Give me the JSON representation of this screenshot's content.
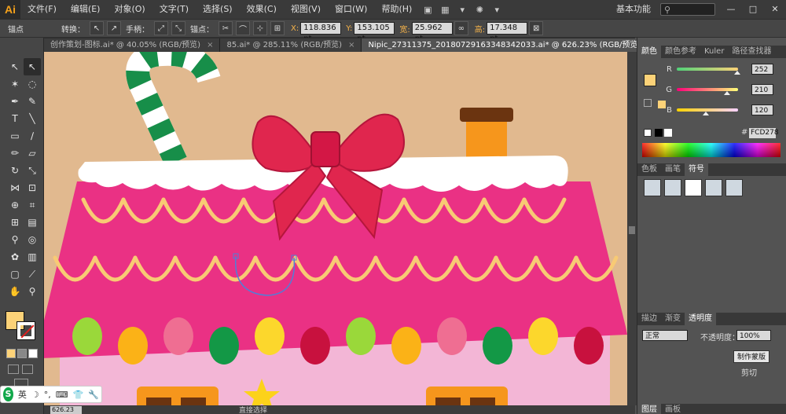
{
  "app": {
    "logo": "Ai"
  },
  "menu": [
    "文件(F)",
    "编辑(E)",
    "对象(O)",
    "文字(T)",
    "选择(S)",
    "效果(C)",
    "视图(V)",
    "窗口(W)",
    "帮助(H)"
  ],
  "header": {
    "workspace": "基本功能",
    "minimize": "—",
    "maximize": "□",
    "close": "✕"
  },
  "control_bar": {
    "selection_label": "锚点",
    "convert_label": "转换：",
    "handle_label": "手柄：",
    "anchor_label": "锚点：",
    "x_label": "X:",
    "x_value": "118.836 pt",
    "y_label": "Y:",
    "y_value": "153.105 pt",
    "w_label": "宽:",
    "w_value": "25.962 pt",
    "h_label": "高:",
    "h_value": "17.348 pt"
  },
  "tabs": [
    {
      "label": "创作策划-图标.ai* @ 40.05% (RGB/预览)",
      "active": false
    },
    {
      "label": "85.ai* @ 285.11% (RGB/预览)",
      "active": false
    },
    {
      "label": "Nipic_27311375_20180729163348342033.ai* @ 626.23% (RGB/预览)",
      "active": true
    }
  ],
  "tools": [
    {
      "name": "selection-tool-icon",
      "glyph": "↖"
    },
    {
      "name": "direct-selection-tool-icon",
      "glyph": "↖"
    },
    {
      "name": "magic-wand-icon",
      "glyph": "✶"
    },
    {
      "name": "lasso-icon",
      "glyph": "◌"
    },
    {
      "name": "pen-tool-icon",
      "glyph": "✒"
    },
    {
      "name": "curvature-tool-icon",
      "glyph": "✎"
    },
    {
      "name": "type-tool-icon",
      "glyph": "T"
    },
    {
      "name": "line-tool-icon",
      "glyph": "╲"
    },
    {
      "name": "rectangle-tool-icon",
      "glyph": "▭"
    },
    {
      "name": "paintbrush-icon",
      "glyph": "∕"
    },
    {
      "name": "pencil-icon",
      "glyph": "✏"
    },
    {
      "name": "eraser-icon",
      "glyph": "▱"
    },
    {
      "name": "rotate-tool-icon",
      "glyph": "↻"
    },
    {
      "name": "scale-tool-icon",
      "glyph": "⤡"
    },
    {
      "name": "width-tool-icon",
      "glyph": "⋈"
    },
    {
      "name": "free-transform-icon",
      "glyph": "⊡"
    },
    {
      "name": "shape-builder-icon",
      "glyph": "⊕"
    },
    {
      "name": "perspective-grid-icon",
      "glyph": "⌗"
    },
    {
      "name": "mesh-tool-icon",
      "glyph": "⊞"
    },
    {
      "name": "gradient-tool-icon",
      "glyph": "▤"
    },
    {
      "name": "eyedropper-icon",
      "glyph": "⚲"
    },
    {
      "name": "blend-tool-icon",
      "glyph": "◎"
    },
    {
      "name": "symbol-sprayer-icon",
      "glyph": "✿"
    },
    {
      "name": "column-graph-icon",
      "glyph": "▥"
    },
    {
      "name": "artboard-tool-icon",
      "glyph": "▢"
    },
    {
      "name": "slice-tool-icon",
      "glyph": "⟋"
    },
    {
      "name": "hand-tool-icon",
      "glyph": "✋"
    },
    {
      "name": "zoom-tool-icon",
      "glyph": "⚲"
    }
  ],
  "status": {
    "zoom": "626.23",
    "text": "直接选择"
  },
  "panels": {
    "color_tabs": [
      "颜色",
      "颜色参考",
      "Kuler",
      "路径查找器"
    ],
    "r_label": "R",
    "r_value": "252",
    "r_level": 0.99,
    "g_label": "G",
    "g_value": "210",
    "g_level": 0.82,
    "b_label": "B",
    "b_value": "120",
    "b_level": 0.47,
    "hex": "FCD278",
    "swatch_tabs": [
      "色板",
      "画笔",
      "符号"
    ],
    "transparency_tabs": [
      "描边",
      "渐变",
      "透明度"
    ],
    "blend_mode": "正常",
    "opacity_label": "不透明度：",
    "opacity_value": "100%",
    "make_mask": "制作蒙版",
    "clip_label": "剪切",
    "layers_tab": "图层",
    "artboard_tab": "画板"
  },
  "ime": {
    "logo": "S",
    "lang": "英",
    "items": [
      "☽",
      "°,",
      "⌨",
      "👕",
      "🔧"
    ]
  },
  "colors": {
    "fill": "#fcd278",
    "roof": "#ea3184",
    "scallop": "#f8ca74",
    "bow": "#e0264e",
    "wall": "#f3b6d6",
    "cane_green": "#178e49",
    "chimney": "#f6961c"
  }
}
